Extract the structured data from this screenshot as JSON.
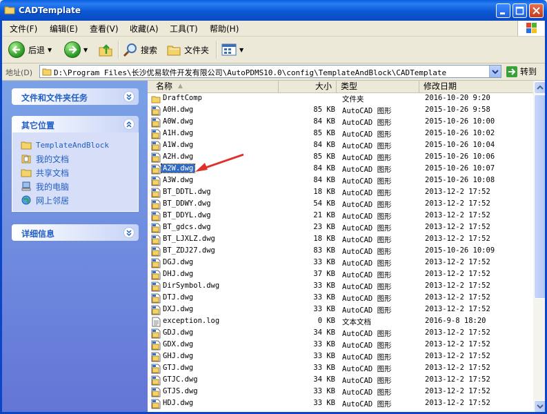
{
  "window": {
    "title": "CADTemplate"
  },
  "menu": [
    "文件(F)",
    "编辑(E)",
    "查看(V)",
    "收藏(A)",
    "工具(T)",
    "帮助(H)"
  ],
  "toolbar": {
    "back_label": "后退",
    "search_label": "搜索",
    "folders_label": "文件夹"
  },
  "address": {
    "label": "地址(D)",
    "path": "D:\\Program Files\\长沙优易软件开发有限公司\\AutoPDMS10.0\\config\\TemplateAndBlock\\CADTemplate",
    "go_label": "转到"
  },
  "sidebar": {
    "panel1": {
      "title": "文件和文件夹任务"
    },
    "panel2": {
      "title": "其它位置",
      "links": [
        "TemplateAndBlock",
        "我的文档",
        "共享文档",
        "我的电脑",
        "网上邻居"
      ]
    },
    "panel3": {
      "title": "详细信息"
    }
  },
  "columns": {
    "name": "名称",
    "size": "大小",
    "type": "类型",
    "date": "修改日期"
  },
  "files": [
    {
      "name": "DraftComp",
      "size": "",
      "type": "文件夹",
      "date": "2016-10-20 9:20",
      "kind": "folder"
    },
    {
      "name": "A0H.dwg",
      "size": "85 KB",
      "type": "AutoCAD 图形",
      "date": "2015-10-26 9:58",
      "kind": "dwg"
    },
    {
      "name": "A0W.dwg",
      "size": "84 KB",
      "type": "AutoCAD 图形",
      "date": "2015-10-26 10:00",
      "kind": "dwg"
    },
    {
      "name": "A1H.dwg",
      "size": "85 KB",
      "type": "AutoCAD 图形",
      "date": "2015-10-26 10:02",
      "kind": "dwg"
    },
    {
      "name": "A1W.dwg",
      "size": "84 KB",
      "type": "AutoCAD 图形",
      "date": "2015-10-26 10:04",
      "kind": "dwg"
    },
    {
      "name": "A2H.dwg",
      "size": "85 KB",
      "type": "AutoCAD 图形",
      "date": "2015-10-26 10:06",
      "kind": "dwg"
    },
    {
      "name": "A2W.dwg",
      "size": "84 KB",
      "type": "AutoCAD 图形",
      "date": "2015-10-26 10:07",
      "kind": "dwg",
      "selected": true
    },
    {
      "name": "A3W.dwg",
      "size": "84 KB",
      "type": "AutoCAD 图形",
      "date": "2015-10-26 10:08",
      "kind": "dwg"
    },
    {
      "name": "BT_DDTL.dwg",
      "size": "18 KB",
      "type": "AutoCAD 图形",
      "date": "2013-12-2 17:52",
      "kind": "dwg"
    },
    {
      "name": "BT_DDWY.dwg",
      "size": "54 KB",
      "type": "AutoCAD 图形",
      "date": "2013-12-2 17:52",
      "kind": "dwg"
    },
    {
      "name": "BT_DDYL.dwg",
      "size": "21 KB",
      "type": "AutoCAD 图形",
      "date": "2013-12-2 17:52",
      "kind": "dwg"
    },
    {
      "name": "BT_gdcs.dwg",
      "size": "23 KB",
      "type": "AutoCAD 图形",
      "date": "2013-12-2 17:52",
      "kind": "dwg"
    },
    {
      "name": "BT_LJXLZ.dwg",
      "size": "18 KB",
      "type": "AutoCAD 图形",
      "date": "2013-12-2 17:52",
      "kind": "dwg"
    },
    {
      "name": "BT_ZDJ27.dwg",
      "size": "83 KB",
      "type": "AutoCAD 图形",
      "date": "2015-10-26 10:09",
      "kind": "dwg"
    },
    {
      "name": "DGJ.dwg",
      "size": "33 KB",
      "type": "AutoCAD 图形",
      "date": "2013-12-2 17:52",
      "kind": "dwg"
    },
    {
      "name": "DHJ.dwg",
      "size": "37 KB",
      "type": "AutoCAD 图形",
      "date": "2013-12-2 17:52",
      "kind": "dwg"
    },
    {
      "name": "DirSymbol.dwg",
      "size": "33 KB",
      "type": "AutoCAD 图形",
      "date": "2013-12-2 17:52",
      "kind": "dwg"
    },
    {
      "name": "DTJ.dwg",
      "size": "33 KB",
      "type": "AutoCAD 图形",
      "date": "2013-12-2 17:52",
      "kind": "dwg"
    },
    {
      "name": "DXJ.dwg",
      "size": "33 KB",
      "type": "AutoCAD 图形",
      "date": "2013-12-2 17:52",
      "kind": "dwg"
    },
    {
      "name": "exception.log",
      "size": "0 KB",
      "type": "文本文档",
      "date": "2016-9-8 18:20",
      "kind": "log"
    },
    {
      "name": "GDJ.dwg",
      "size": "34 KB",
      "type": "AutoCAD 图形",
      "date": "2013-12-2 17:52",
      "kind": "dwg"
    },
    {
      "name": "GDX.dwg",
      "size": "33 KB",
      "type": "AutoCAD 图形",
      "date": "2013-12-2 17:52",
      "kind": "dwg"
    },
    {
      "name": "GHJ.dwg",
      "size": "33 KB",
      "type": "AutoCAD 图形",
      "date": "2013-12-2 17:52",
      "kind": "dwg"
    },
    {
      "name": "GTJ.dwg",
      "size": "33 KB",
      "type": "AutoCAD 图形",
      "date": "2013-12-2 17:52",
      "kind": "dwg"
    },
    {
      "name": "GTJC.dwg",
      "size": "34 KB",
      "type": "AutoCAD 图形",
      "date": "2013-12-2 17:52",
      "kind": "dwg"
    },
    {
      "name": "GTJS.dwg",
      "size": "33 KB",
      "type": "AutoCAD 图形",
      "date": "2013-12-2 17:52",
      "kind": "dwg"
    },
    {
      "name": "HDJ.dwg",
      "size": "33 KB",
      "type": "AutoCAD 图形",
      "date": "2013-12-2 17:52",
      "kind": "dwg"
    }
  ],
  "colors": {
    "selection": "#316ac5",
    "link": "#215dc6",
    "annotation_arrow": "#e0302a"
  }
}
